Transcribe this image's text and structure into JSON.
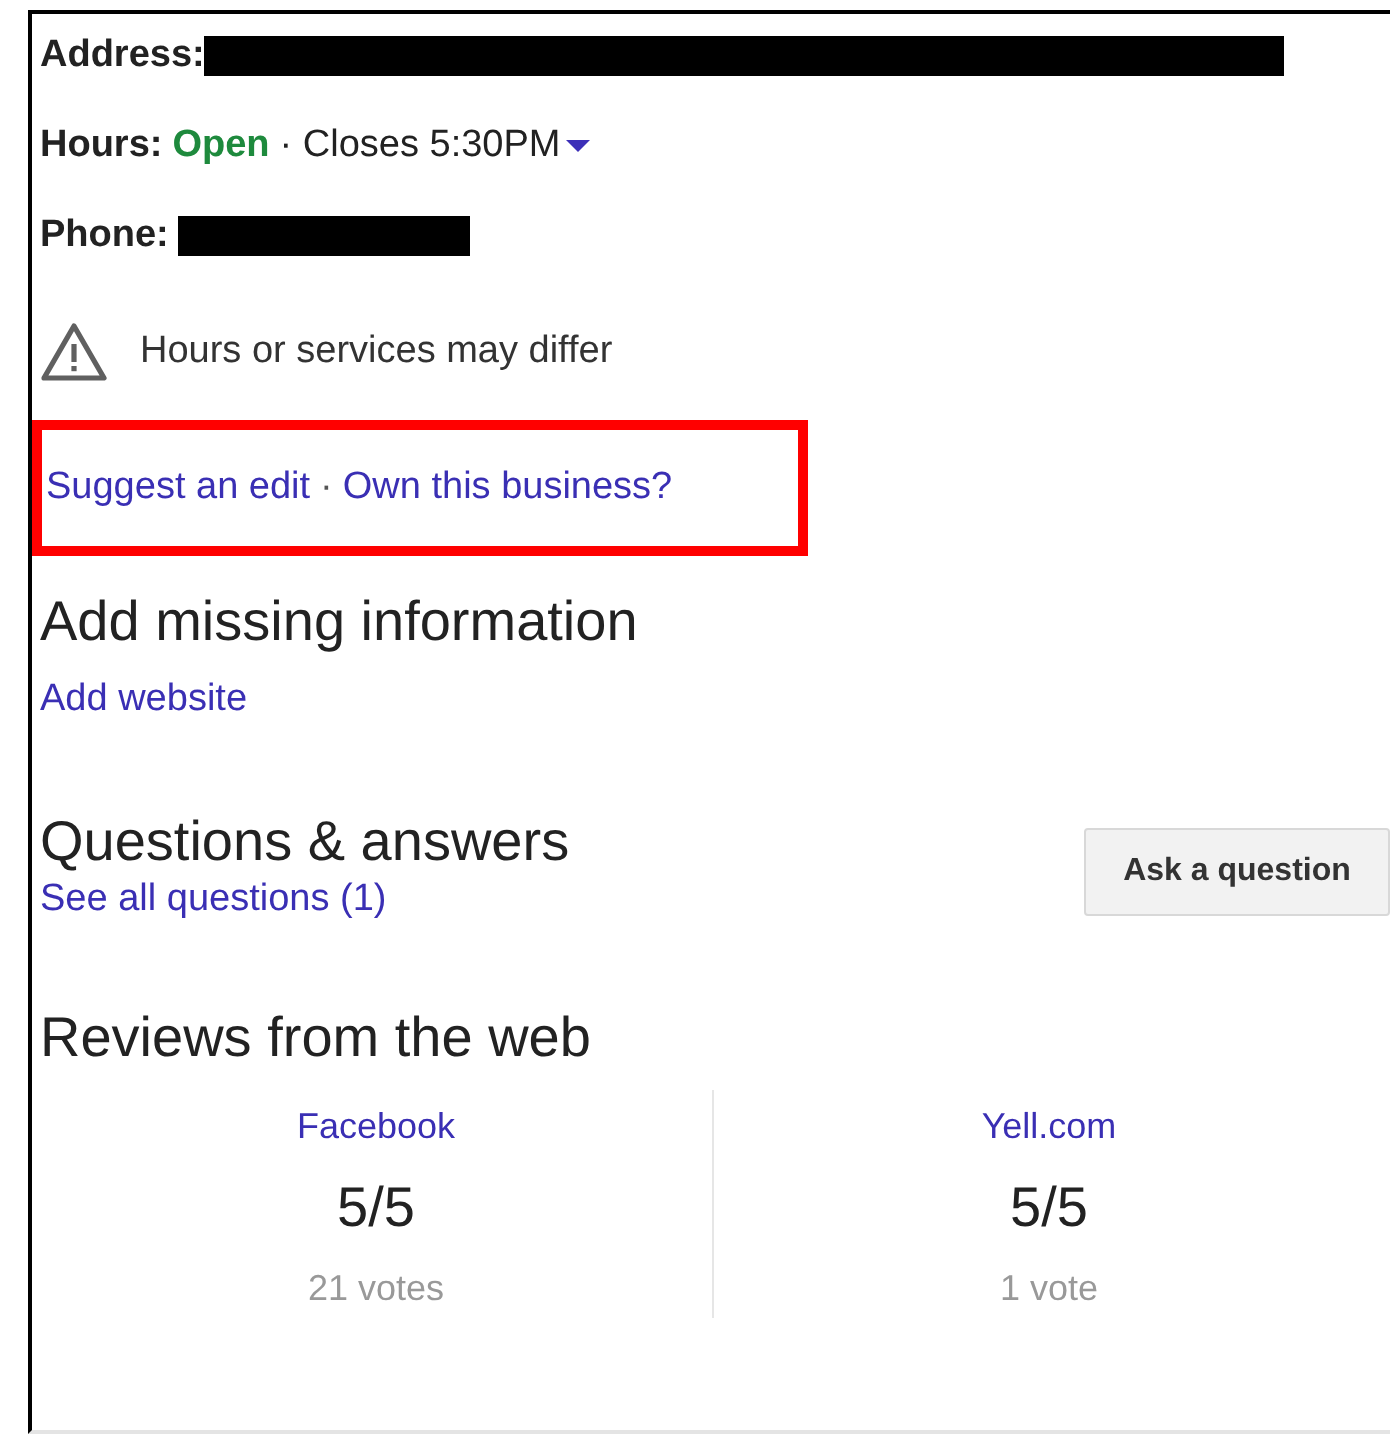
{
  "details": [
    {
      "kind": "address",
      "label": "Address:",
      "redacted": true
    },
    {
      "kind": "hours",
      "label": "Hours:",
      "status": "Open",
      "text": "· Closes 5:30PM",
      "expandable": true
    },
    {
      "kind": "phone",
      "label": "Phone:",
      "redacted": true
    }
  ],
  "notice": {
    "text": "Hours or services may differ"
  },
  "edit_links": {
    "highlighted": true,
    "links": [
      "Suggest an edit",
      "Own this business?"
    ],
    "separator": "·"
  },
  "missing_info": {
    "title": "Add missing information",
    "links": [
      "Add website"
    ]
  },
  "questions": {
    "title": "Questions & answers",
    "link": "See all questions (1)",
    "button": "Ask a question"
  },
  "reviews": {
    "title": "Reviews from the web",
    "sources": [
      {
        "source": "Facebook",
        "score": "5/5",
        "votes": "21 votes"
      },
      {
        "source": "Yell.com",
        "score": "5/5",
        "votes": "1 vote"
      }
    ]
  }
}
